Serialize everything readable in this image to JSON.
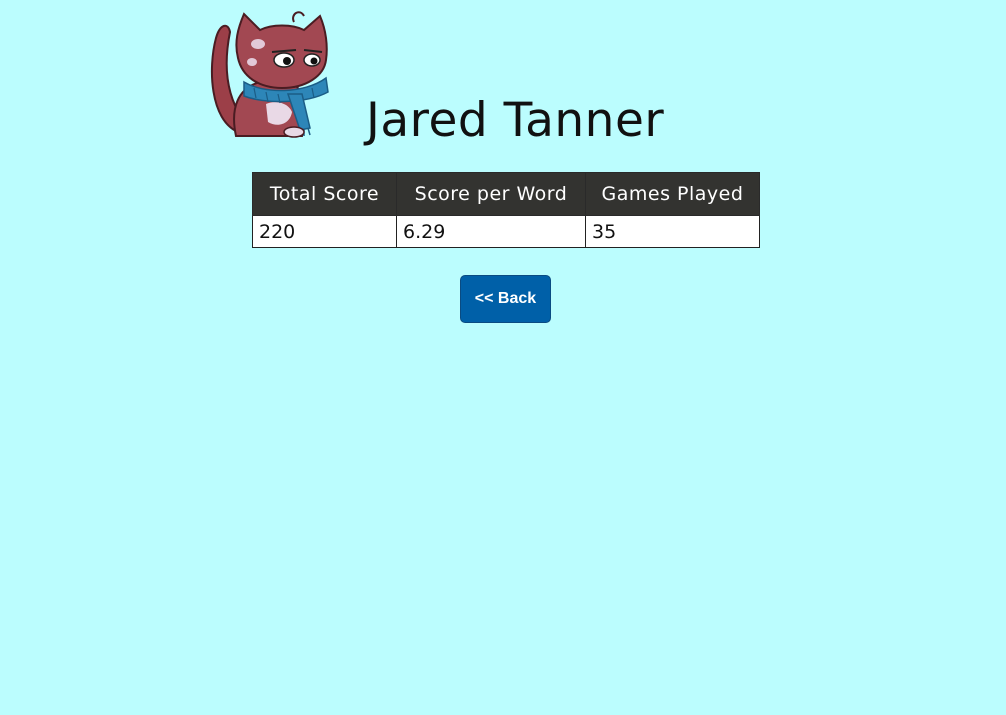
{
  "player": {
    "name": "Jared Tanner",
    "avatar_icon": "cat-with-scarf-avatar"
  },
  "stats": {
    "headers": {
      "total_score": "Total Score",
      "score_per_word": "Score per Word",
      "games_played": "Games Played"
    },
    "values": {
      "total_score": "220",
      "score_per_word": "6.29",
      "games_played": "35"
    }
  },
  "actions": {
    "back_label": "<< Back"
  },
  "colors": {
    "page_background": "#bbfdfe",
    "table_header_bg": "#333330",
    "button_bg": "#0060a8"
  }
}
